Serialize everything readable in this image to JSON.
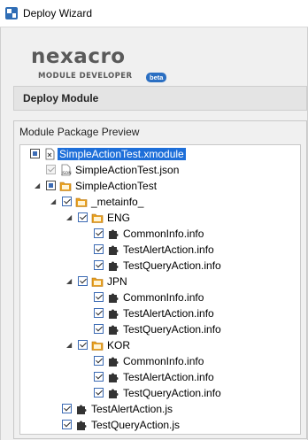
{
  "window": {
    "title": "Deploy Wizard"
  },
  "logo": {
    "word": "nexacro",
    "subtitle": "MODULE DEVELOPER",
    "badge": "beta"
  },
  "section": {
    "title": "Deploy Module"
  },
  "preview": {
    "title": "Module Package Preview",
    "nodes": [
      {
        "label": "SimpleActionTest.xmodule",
        "depth": 0,
        "expander": "none",
        "check": "partial",
        "icon": "xmodule-file-icon",
        "selected": true
      },
      {
        "label": "SimpleActionTest.json",
        "depth": 1,
        "expander": "none",
        "check": "disabled",
        "icon": "json-file-icon",
        "selected": false
      },
      {
        "label": "SimpleActionTest",
        "depth": 1,
        "expander": "expanded",
        "check": "partial",
        "icon": "folder-icon",
        "selected": false
      },
      {
        "label": "_metainfo_",
        "depth": 2,
        "expander": "expanded",
        "check": "checked",
        "icon": "folder-icon",
        "selected": false
      },
      {
        "label": "ENG",
        "depth": 3,
        "expander": "expanded",
        "check": "checked",
        "icon": "folder-icon",
        "selected": false
      },
      {
        "label": "CommonInfo.info",
        "depth": 4,
        "expander": "none",
        "check": "checked",
        "icon": "puzzle-icon",
        "selected": false
      },
      {
        "label": "TestAlertAction.info",
        "depth": 4,
        "expander": "none",
        "check": "checked",
        "icon": "puzzle-icon",
        "selected": false
      },
      {
        "label": "TestQueryAction.info",
        "depth": 4,
        "expander": "none",
        "check": "checked",
        "icon": "puzzle-icon",
        "selected": false
      },
      {
        "label": "JPN",
        "depth": 3,
        "expander": "expanded",
        "check": "checked",
        "icon": "folder-icon",
        "selected": false
      },
      {
        "label": "CommonInfo.info",
        "depth": 4,
        "expander": "none",
        "check": "checked",
        "icon": "puzzle-icon",
        "selected": false
      },
      {
        "label": "TestAlertAction.info",
        "depth": 4,
        "expander": "none",
        "check": "checked",
        "icon": "puzzle-icon",
        "selected": false
      },
      {
        "label": "TestQueryAction.info",
        "depth": 4,
        "expander": "none",
        "check": "checked",
        "icon": "puzzle-icon",
        "selected": false
      },
      {
        "label": "KOR",
        "depth": 3,
        "expander": "expanded",
        "check": "checked",
        "icon": "folder-icon",
        "selected": false
      },
      {
        "label": "CommonInfo.info",
        "depth": 4,
        "expander": "none",
        "check": "checked",
        "icon": "puzzle-icon",
        "selected": false
      },
      {
        "label": "TestAlertAction.info",
        "depth": 4,
        "expander": "none",
        "check": "checked",
        "icon": "puzzle-icon",
        "selected": false
      },
      {
        "label": "TestQueryAction.info",
        "depth": 4,
        "expander": "none",
        "check": "checked",
        "icon": "puzzle-icon",
        "selected": false
      },
      {
        "label": "TestAlertAction.js",
        "depth": 2,
        "expander": "none",
        "check": "checked",
        "icon": "puzzle-icon",
        "selected": false
      },
      {
        "label": "TestQueryAction.js",
        "depth": 2,
        "expander": "none",
        "check": "checked",
        "icon": "puzzle-icon",
        "selected": false
      }
    ]
  },
  "colors": {
    "selection": "#1e6fd9",
    "folder": "#e8a020",
    "badge": "#2b6fc2"
  }
}
